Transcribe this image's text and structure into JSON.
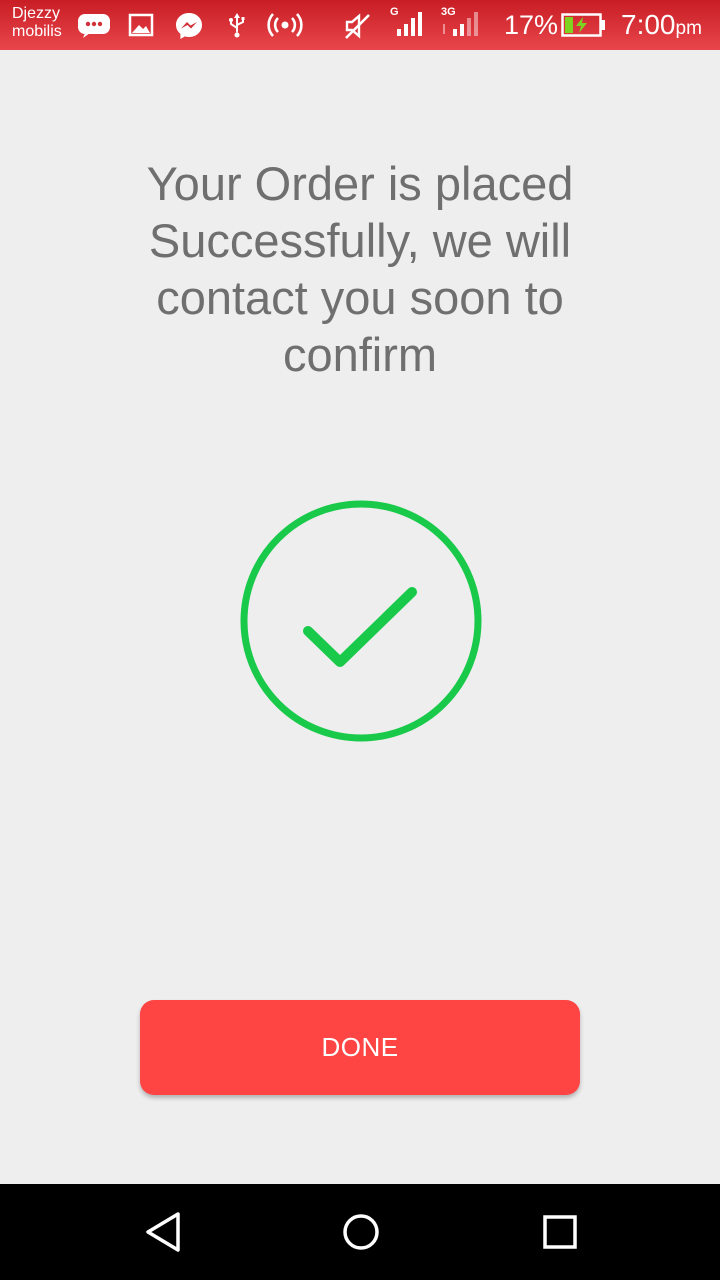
{
  "status_bar": {
    "carrier_line1": "Djezzy",
    "carrier_line2": "mobilis",
    "network_g": "G",
    "network_3g": "3G",
    "battery_percent": "17%",
    "time": "7:00",
    "time_suffix": "pm",
    "icons": [
      "message-icon",
      "gallery-icon",
      "messenger-icon",
      "usb-icon",
      "hotspot-icon",
      "mute-icon",
      "signal-g-icon",
      "signal-3g-icon",
      "battery-charging-icon"
    ]
  },
  "main": {
    "message": "Your Order is placed Successfully, we will contact you soon to confirm",
    "success_icon": "check-circle-icon",
    "success_color": "#18c94a"
  },
  "done_button": {
    "label": "DONE",
    "color": "#ff4444"
  },
  "nav_bar": {
    "icons": [
      "back-icon",
      "home-icon",
      "recents-icon"
    ]
  }
}
